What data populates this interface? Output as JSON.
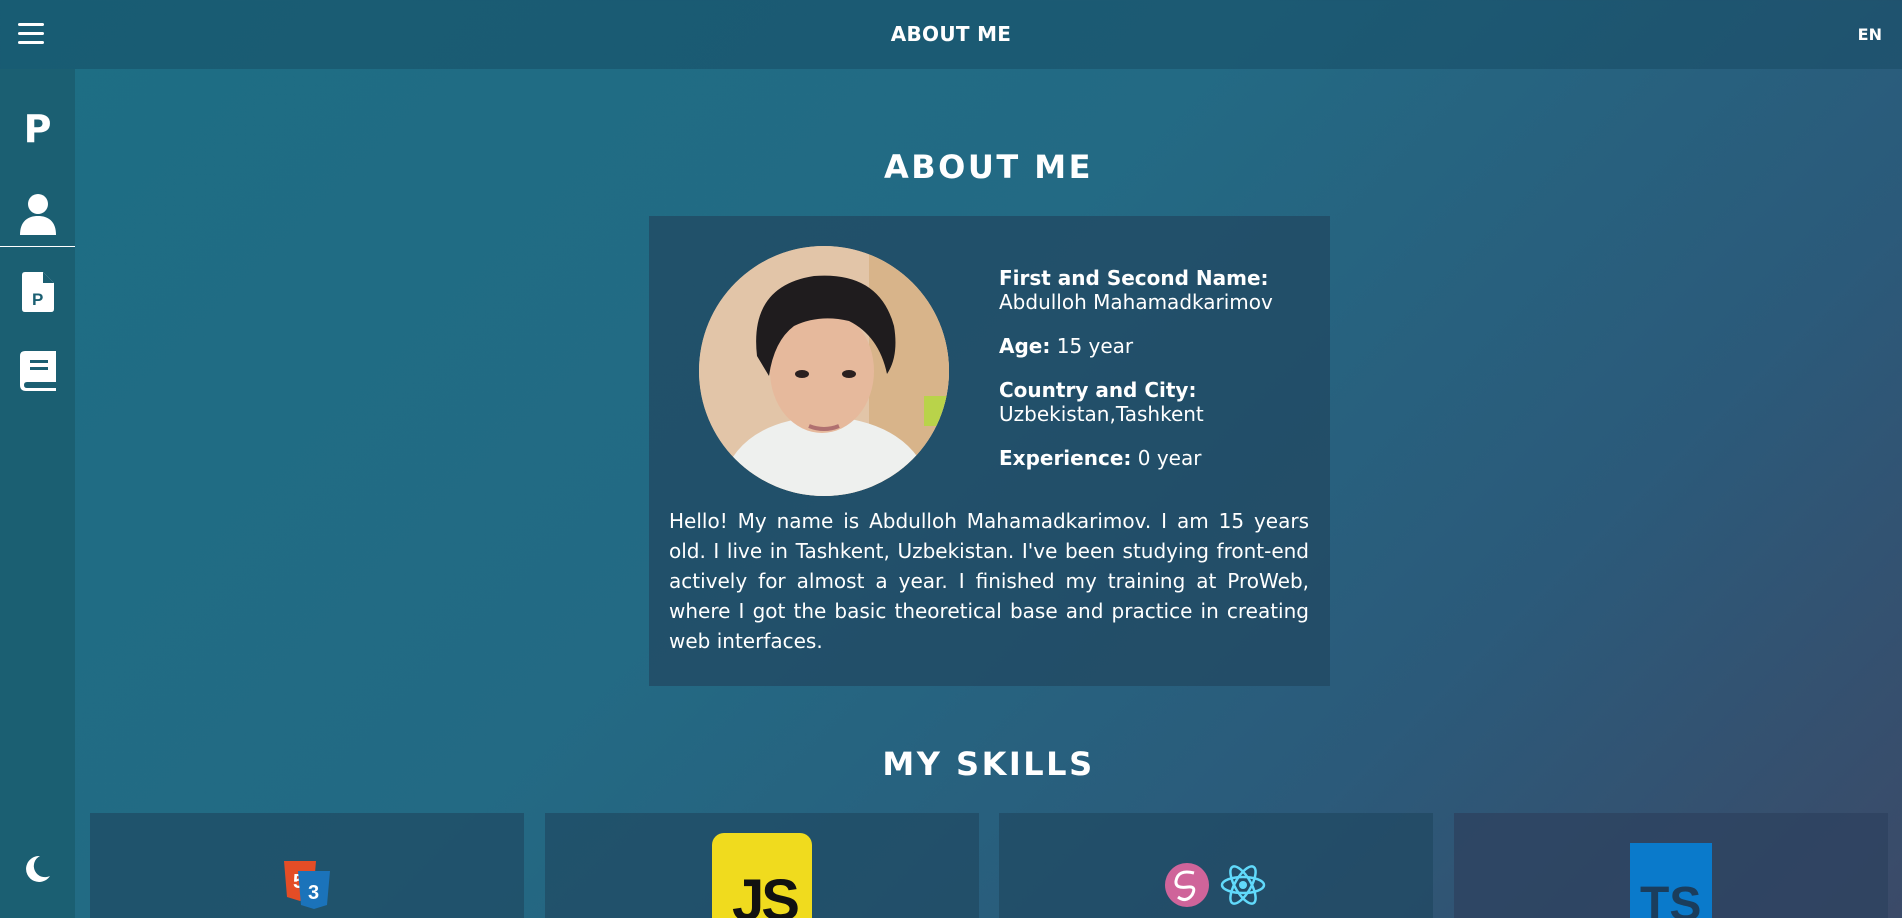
{
  "header": {
    "title": "ABOUT ME",
    "lang": "EN"
  },
  "sidebar": {
    "logo": "P",
    "items": [
      {
        "icon": "user-icon"
      },
      {
        "icon": "document-p-icon"
      },
      {
        "icon": "book-icon"
      }
    ],
    "theme_icon": "moon-icon"
  },
  "about": {
    "title": "ABOUT ME",
    "name_label": "First and Second Name:",
    "name_value": "Abdulloh Mahamadkarimov",
    "age_label": "Age:",
    "age_value": "15 year",
    "location_label": "Country and City:",
    "location_value": "Uzbekistan,Tashkent",
    "experience_label": "Experience:",
    "experience_value": "0 year",
    "bio": "Hello! My name is Abdulloh Mahamadkarimov. I am 15 years old. I live in Tashkent, Uzbekistan. I've been studying front-end actively for almost a year. I finished my training at ProWeb, where I got the basic theoretical base and practice in creating web interfaces."
  },
  "skills": {
    "title": "MY SKILLS",
    "cards": [
      {
        "icon": "html5-css3-icon"
      },
      {
        "icon": "javascript-icon",
        "label": "JS"
      },
      {
        "icon": "sass-react-icon"
      },
      {
        "icon": "typescript-icon",
        "label": "TS"
      }
    ]
  },
  "colors": {
    "js_yellow": "#f0db1e",
    "ts_blue": "#0a7acb",
    "sass_pink": "#cf649a",
    "react_cyan": "#61dafb",
    "html_orange": "#e44d26",
    "css_blue": "#1b73ba"
  }
}
